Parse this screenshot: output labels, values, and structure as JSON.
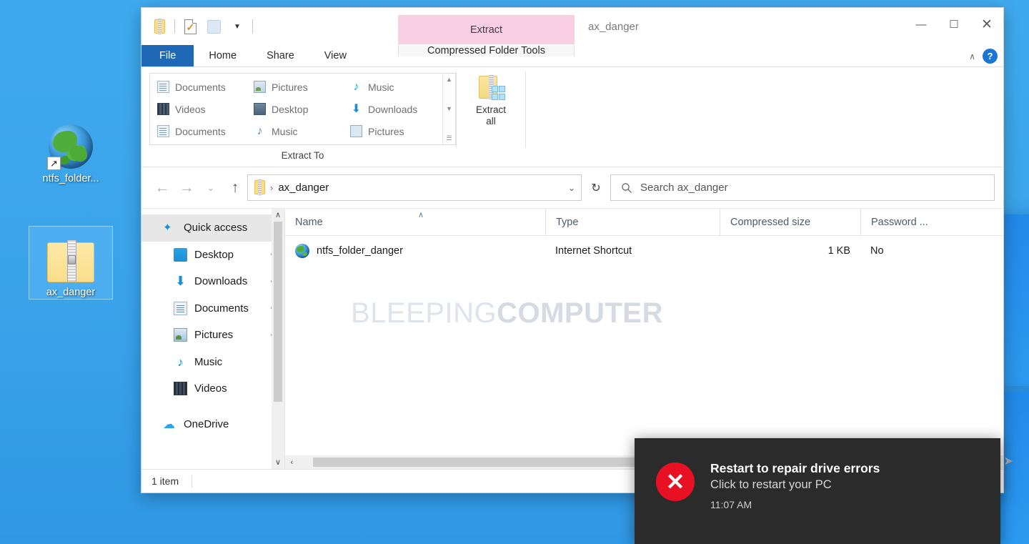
{
  "desktop": {
    "icons": [
      {
        "label": "ntfs_folder...",
        "icon": "globe-shortcut-icon",
        "selected": false
      },
      {
        "label": "ax_danger",
        "icon": "zip-folder-icon",
        "selected": true
      }
    ],
    "background_color": "#3daaf0"
  },
  "window": {
    "title": "ax_danger",
    "contextual_tab_header": "Extract",
    "contextual_tab_color": "#fbcfe3",
    "controls": {
      "minimize": "—",
      "maximize": "☐",
      "close": "✕"
    },
    "quick_access_toolbar": [
      {
        "name": "zip-folder-icon"
      },
      {
        "name": "properties-icon"
      },
      {
        "name": "new-folder-icon"
      },
      {
        "name": "customize-caret-icon"
      }
    ],
    "ribbon_collapse": "∧",
    "help_label": "?"
  },
  "tabs": [
    {
      "label": "File",
      "active": true,
      "kind": "file"
    },
    {
      "label": "Home",
      "active": false,
      "kind": "normal"
    },
    {
      "label": "Share",
      "active": false,
      "kind": "normal"
    },
    {
      "label": "View",
      "active": false,
      "kind": "normal"
    },
    {
      "label": "Compressed Folder Tools",
      "active": true,
      "kind": "contextual"
    }
  ],
  "ribbon": {
    "group_label": "Extract To",
    "gallery": [
      {
        "label": "Documents",
        "icon": "documents-icon"
      },
      {
        "label": "Pictures",
        "icon": "pictures-icon"
      },
      {
        "label": "Music",
        "icon": "music-icon"
      },
      {
        "label": "Videos",
        "icon": "videos-icon"
      },
      {
        "label": "Desktop",
        "icon": "desktop-icon"
      },
      {
        "label": "Downloads",
        "icon": "downloads-icon"
      },
      {
        "label": "Documents",
        "icon": "documents-pc-icon"
      },
      {
        "label": "Music",
        "icon": "music-pc-icon"
      },
      {
        "label": "Pictures",
        "icon": "pictures-pc-icon"
      }
    ],
    "gallery_scroll": {
      "up": "▲",
      "down": "▼",
      "more": "☰"
    },
    "extract_all": {
      "line1": "Extract",
      "line2": "all",
      "icon": "extract-all-icon"
    }
  },
  "addressbar": {
    "back": "←",
    "forward": "→",
    "recent": "⌄",
    "up": "↑",
    "crumb_icon": "zip-folder-icon",
    "separator": "›",
    "path": "ax_danger",
    "dropdown": "⌄",
    "refresh": "↻"
  },
  "search": {
    "icon": "search-icon",
    "placeholder": "Search ax_danger",
    "value": ""
  },
  "navpane": {
    "items": [
      {
        "label": "Quick access",
        "icon": "quick-access-star-icon",
        "selected": true,
        "pinned": false,
        "level": "root"
      },
      {
        "label": "Desktop",
        "icon": "desktop-icon",
        "selected": false,
        "pinned": true,
        "level": "sub"
      },
      {
        "label": "Downloads",
        "icon": "downloads-icon",
        "selected": false,
        "pinned": true,
        "level": "sub"
      },
      {
        "label": "Documents",
        "icon": "documents-icon",
        "selected": false,
        "pinned": true,
        "level": "sub"
      },
      {
        "label": "Pictures",
        "icon": "pictures-icon",
        "selected": false,
        "pinned": true,
        "level": "sub"
      },
      {
        "label": "Music",
        "icon": "music-icon",
        "selected": false,
        "pinned": false,
        "level": "sub"
      },
      {
        "label": "Videos",
        "icon": "videos-icon",
        "selected": false,
        "pinned": false,
        "level": "sub"
      },
      {
        "label": "OneDrive",
        "icon": "onedrive-cloud-icon",
        "selected": false,
        "pinned": false,
        "level": "root"
      }
    ],
    "scroll_up": "∧",
    "scroll_down": "∨",
    "pin_glyph": "✒"
  },
  "filelist": {
    "columns": [
      {
        "label": "Name",
        "sorted": true,
        "sort_glyph": "∧"
      },
      {
        "label": "Type",
        "sorted": false
      },
      {
        "label": "Compressed size",
        "sorted": false
      },
      {
        "label": "Password ...",
        "sorted": false
      }
    ],
    "rows": [
      {
        "name": "ntfs_folder_danger",
        "icon": "internet-shortcut-globe-icon",
        "type": "Internet Shortcut",
        "compressed_size": "1 KB",
        "password": "No"
      }
    ],
    "watermark_light": "BLEEPING",
    "watermark_bold": "COMPUTER",
    "hscroll_left": "‹",
    "hscroll_right": "›"
  },
  "statusbar": {
    "item_count": "1 item"
  },
  "toast": {
    "icon": "error-x-icon",
    "icon_color": "#e81123",
    "title": "Restart to repair drive errors",
    "subtitle": "Click to restart your PC",
    "time": "11:07 AM",
    "expand_arrow": "➤"
  }
}
